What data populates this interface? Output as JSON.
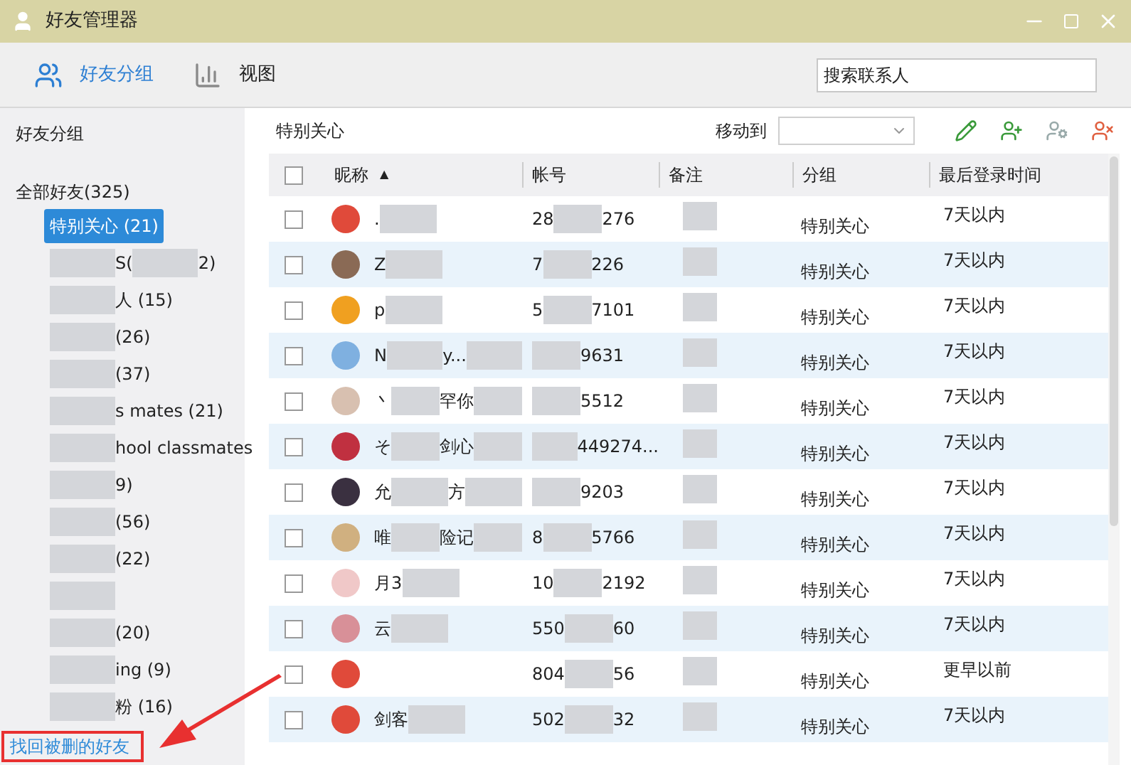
{
  "window": {
    "title": "好友管理器"
  },
  "tabs": [
    {
      "label": "好友分组",
      "selected": true,
      "kind": "groups"
    },
    {
      "label": "视图",
      "selected": false,
      "kind": "chart"
    }
  ],
  "search": {
    "placeholder": "搜索联系人"
  },
  "sidebar": {
    "title": "好友分组",
    "all": "全部好友(325)",
    "items": [
      {
        "parts": [
          "特别关心 (21)"
        ],
        "blurred": false,
        "selected": true
      },
      {
        "parts": [
          "S(",
          "2)"
        ],
        "blurred": true,
        "selected": false
      },
      {
        "parts": [
          "人 (15)"
        ],
        "blurred": true,
        "selected": false
      },
      {
        "parts": [
          "(26)"
        ],
        "blurred": true,
        "selected": false
      },
      {
        "parts": [
          "(37)"
        ],
        "blurred": true,
        "selected": false
      },
      {
        "parts": [
          "s mates (21)"
        ],
        "blurred": true,
        "selected": false
      },
      {
        "parts": [
          "hool classmates"
        ],
        "blurred": true,
        "selected": false
      },
      {
        "parts": [
          "9)"
        ],
        "blurred": true,
        "selected": false
      },
      {
        "parts": [
          "(56)"
        ],
        "blurred": true,
        "selected": false
      },
      {
        "parts": [
          "(22)"
        ],
        "blurred": true,
        "selected": false
      },
      {
        "blurred": true,
        "selected": false
      },
      {
        "parts": [
          "(20)"
        ],
        "blurred": true,
        "selected": false
      },
      {
        "parts": [
          "ing (9)"
        ],
        "blurred": true,
        "selected": false
      },
      {
        "parts": [
          "粉 (16)"
        ],
        "blurred": true,
        "selected": false
      }
    ],
    "footer_link": "找回被删的好友"
  },
  "list": {
    "title": "特别关心",
    "move_label": "移动到",
    "columns": [
      "昵称",
      "帐号",
      "备注",
      "分组",
      "最后登录时间"
    ],
    "sort_arrow": "▲",
    "select_all_checked": false,
    "rows": [
      {
        "checked": false,
        "nickname": [
          "."
        ],
        "account": [
          "28",
          "276"
        ],
        "group": "特别关心",
        "last_login": "7天以内"
      },
      {
        "checked": false,
        "nickname": [
          "Z"
        ],
        "account": [
          "7",
          "226"
        ],
        "group": "特别关心",
        "last_login": "7天以内"
      },
      {
        "checked": false,
        "nickname": [
          "p"
        ],
        "account": [
          "5",
          "7101"
        ],
        "group": "特别关心",
        "last_login": "7天以内"
      },
      {
        "checked": false,
        "nickname": [
          "N",
          "y..."
        ],
        "account": [
          "9631"
        ],
        "group": "特别关心",
        "last_login": "7天以内"
      },
      {
        "checked": false,
        "nickname": [
          "丶",
          "罕你"
        ],
        "account": [
          "5512"
        ],
        "group": "特别关心",
        "last_login": "7天以内"
      },
      {
        "checked": false,
        "nickname": [
          "そ",
          "剑心"
        ],
        "account": [
          "449274..."
        ],
        "group": "特别关心",
        "last_login": "7天以内"
      },
      {
        "checked": false,
        "nickname": [
          "允",
          "方"
        ],
        "account": [
          "9203"
        ],
        "group": "特别关心",
        "last_login": "7天以内"
      },
      {
        "checked": false,
        "nickname": [
          "唯",
          "险记"
        ],
        "account": [
          "8",
          "5766"
        ],
        "group": "特别关心",
        "last_login": "7天以内"
      },
      {
        "checked": false,
        "nickname": [
          "月3"
        ],
        "account": [
          "10",
          "2192"
        ],
        "group": "特别关心",
        "last_login": "7天以内"
      },
      {
        "checked": false,
        "nickname": [
          "云"
        ],
        "account": [
          "550",
          "60"
        ],
        "group": "特别关心",
        "last_login": "7天以内"
      },
      {
        "checked": false,
        "account": [
          "804",
          "56"
        ],
        "group": "特别关心",
        "last_login": "更早以前"
      },
      {
        "checked": false,
        "nickname": [
          "剑客"
        ],
        "account": [
          "502",
          "32"
        ],
        "group": "特别关心",
        "last_login": "7天以内"
      }
    ]
  }
}
